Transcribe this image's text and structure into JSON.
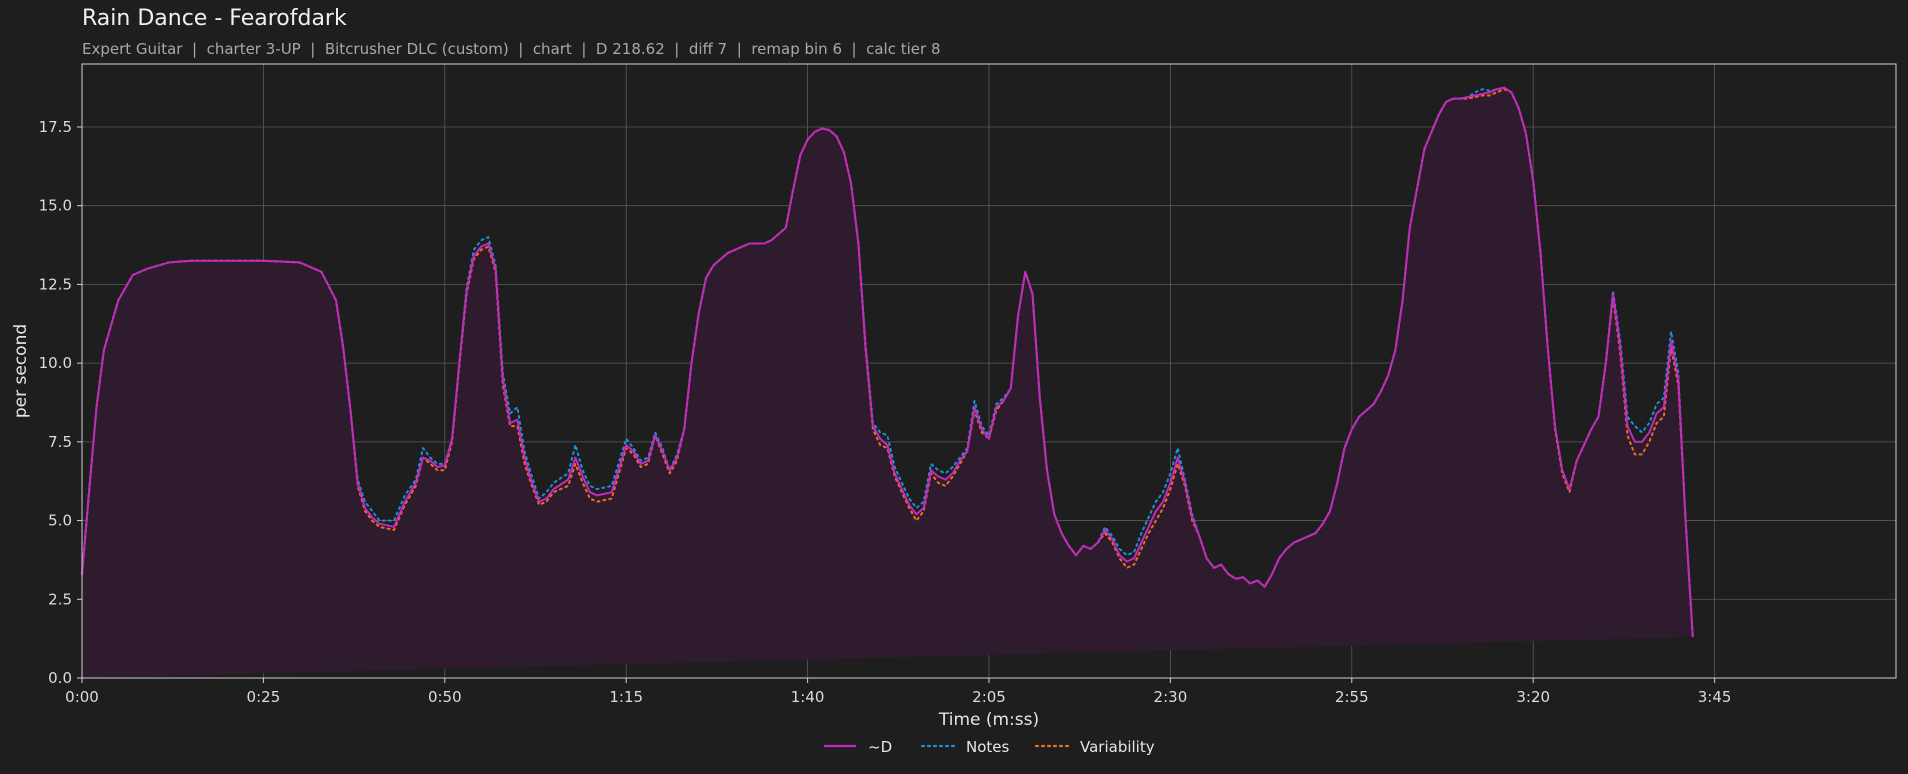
{
  "title": "Rain Dance - Fearofdark",
  "subtitle": "Expert Guitar  |  charter 3-UP  |  Bitcrusher DLC (custom)  |  chart  |  D 218.62  |  diff 7  |  remap bin 6  |  calc tier 8",
  "colors": {
    "background": "#1e1e1e",
    "D": "#c02bbd",
    "Notes": "#1f8fd6",
    "Variability": "#ef6c1f",
    "fill": "#2e1c2e",
    "grid": "#5a5a5a"
  },
  "chart_data": {
    "type": "line",
    "xlabel": "Time (m:ss)",
    "ylabel": "per second",
    "xlim": [
      0,
      250
    ],
    "ylim": [
      0,
      19.5
    ],
    "x_ticks": [
      0,
      25,
      50,
      75,
      100,
      125,
      150,
      175,
      200,
      225
    ],
    "x_tick_labels": [
      "0:00",
      "0:25",
      "0:50",
      "1:15",
      "1:40",
      "2:05",
      "2:30",
      "2:55",
      "3:20",
      "3:45"
    ],
    "y_ticks": [
      0,
      2.5,
      5,
      7.5,
      10,
      12.5,
      15,
      17.5
    ],
    "y_tick_labels": [
      "0.0",
      "2.5",
      "5.0",
      "7.5",
      "10.0",
      "12.5",
      "15.0",
      "17.5"
    ],
    "grid": true,
    "legend_position": "bottom-center",
    "x": [
      0,
      1,
      2,
      3,
      5,
      7,
      9,
      12,
      15,
      20,
      25,
      30,
      33,
      35,
      36,
      37,
      38,
      39,
      40,
      41,
      43,
      44.5,
      46,
      47,
      48,
      49,
      50,
      51,
      52,
      53,
      54,
      55,
      56,
      57,
      58,
      59,
      60,
      61,
      62,
      63,
      64,
      65,
      67,
      68,
      69,
      70,
      71,
      72,
      73,
      75,
      76,
      77,
      78,
      79,
      80,
      81,
      82,
      83,
      84,
      85,
      86,
      87,
      88,
      89,
      90,
      91,
      92,
      93,
      94,
      95,
      96,
      97,
      98,
      99,
      100,
      101,
      102,
      103,
      104,
      105,
      106,
      107,
      108,
      109,
      110,
      111,
      112,
      113,
      114,
      115,
      116,
      117,
      118,
      119,
      120,
      121,
      122,
      123,
      124,
      125,
      126,
      127,
      128,
      129,
      130,
      131,
      132,
      133,
      134,
      135,
      136,
      137,
      138,
      139,
      140,
      141,
      142,
      143,
      144,
      145,
      146,
      147,
      148,
      149,
      150,
      151,
      152,
      153,
      154,
      155,
      156,
      157,
      158,
      159,
      160,
      161,
      162,
      163,
      164,
      165,
      166,
      167,
      168,
      169,
      170,
      171,
      172,
      173,
      174,
      175,
      176,
      177,
      178,
      179,
      180,
      181,
      182,
      183,
      185,
      187,
      188,
      189,
      190,
      191,
      192,
      193,
      194,
      195,
      196,
      197,
      198,
      199,
      200,
      201,
      202,
      203,
      204,
      205,
      206,
      207,
      208,
      209,
      210,
      211,
      212,
      213,
      214,
      215,
      216,
      217,
      218,
      219,
      220,
      221,
      222,
      223,
      224,
      225,
      226,
      227,
      228,
      229,
      230,
      231,
      232,
      233,
      234,
      235,
      236,
      237,
      238,
      239,
      240,
      241,
      242,
      243,
      244,
      245,
      246,
      247,
      248,
      249,
      250
    ],
    "series": [
      {
        "name": "~D",
        "style": "solid",
        "values": [
          3.3,
          6.0,
          8.6,
          10.4,
          12.0,
          12.8,
          13.0,
          13.2,
          13.25,
          13.25,
          13.25,
          13.2,
          12.9,
          12.0,
          10.5,
          8.5,
          6.2,
          5.4,
          5.1,
          4.9,
          4.8,
          5.6,
          6.2,
          7.0,
          6.9,
          6.7,
          6.75,
          7.6,
          10.0,
          12.3,
          13.4,
          13.7,
          13.8,
          13.0,
          9.5,
          8.1,
          8.2,
          7.0,
          6.2,
          5.6,
          5.7,
          6.0,
          6.3,
          7.0,
          6.4,
          5.9,
          5.8,
          5.85,
          5.9,
          7.4,
          7.2,
          6.8,
          6.9,
          7.7,
          7.2,
          6.6,
          7.0,
          7.9,
          10.0,
          11.6,
          12.7,
          13.1,
          13.3,
          13.5,
          13.6,
          13.7,
          13.8,
          13.8,
          13.8,
          13.9,
          14.1,
          14.3,
          15.5,
          16.6,
          17.1,
          17.35,
          17.45,
          17.4,
          17.2,
          16.7,
          15.7,
          13.8,
          10.5,
          8.0,
          7.6,
          7.4,
          6.5,
          6.0,
          5.5,
          5.2,
          5.4,
          6.6,
          6.4,
          6.3,
          6.5,
          6.9,
          7.2,
          8.6,
          7.9,
          7.6,
          8.6,
          8.8,
          9.2,
          11.5,
          12.9,
          12.2,
          8.9,
          6.6,
          5.2,
          4.6,
          4.2,
          3.9,
          4.2,
          4.1,
          4.3,
          4.7,
          4.4,
          3.9,
          3.7,
          3.8,
          4.3,
          4.8,
          5.3,
          5.6,
          6.2,
          7.0,
          6.2,
          5.1,
          4.5,
          3.8,
          3.5,
          3.6,
          3.3,
          3.15,
          3.2,
          3.0,
          3.1,
          2.9,
          3.3,
          3.8,
          4.1,
          4.3,
          4.4,
          4.5,
          4.6,
          4.9,
          5.3,
          6.2,
          7.3,
          7.9,
          8.3,
          8.5,
          8.7,
          9.1,
          9.6,
          10.4,
          12.0,
          14.3,
          16.8,
          17.9,
          18.3,
          18.4,
          18.4,
          18.45,
          18.5,
          18.55,
          18.6,
          18.7,
          18.75,
          18.6,
          18.1,
          17.3,
          15.8,
          13.5,
          10.5,
          8.0,
          6.6,
          6.0,
          6.9,
          7.4,
          7.9,
          8.3,
          10.0,
          12.2,
          10.5,
          8.0,
          7.5,
          7.5,
          7.8,
          8.4,
          8.6,
          10.7,
          9.5,
          5.0,
          1.3
        ]
      },
      {
        "name": "Notes",
        "style": "dotted",
        "values": [
          3.3,
          6.0,
          8.6,
          10.4,
          12.0,
          12.8,
          13.0,
          13.2,
          13.25,
          13.25,
          13.25,
          13.2,
          12.9,
          12.0,
          10.5,
          8.5,
          6.3,
          5.6,
          5.3,
          5.0,
          5.0,
          5.8,
          6.3,
          7.3,
          7.0,
          6.8,
          6.8,
          7.6,
          10.0,
          12.4,
          13.6,
          13.9,
          14.0,
          13.1,
          9.7,
          8.4,
          8.6,
          7.2,
          6.4,
          5.7,
          5.9,
          6.2,
          6.5,
          7.4,
          6.6,
          6.1,
          6.0,
          6.05,
          6.1,
          7.6,
          7.3,
          6.9,
          7.0,
          7.8,
          7.3,
          6.6,
          7.1,
          7.9,
          10.0,
          11.6,
          12.7,
          13.1,
          13.3,
          13.5,
          13.6,
          13.7,
          13.8,
          13.8,
          13.8,
          13.9,
          14.1,
          14.3,
          15.5,
          16.6,
          17.1,
          17.35,
          17.45,
          17.4,
          17.2,
          16.7,
          15.7,
          13.8,
          10.6,
          8.1,
          7.8,
          7.7,
          6.7,
          6.2,
          5.7,
          5.4,
          5.6,
          6.8,
          6.6,
          6.5,
          6.7,
          7.0,
          7.3,
          8.8,
          8.0,
          7.7,
          8.7,
          8.9,
          9.2,
          11.5,
          12.9,
          12.2,
          8.9,
          6.6,
          5.2,
          4.6,
          4.2,
          3.9,
          4.2,
          4.1,
          4.3,
          4.8,
          4.5,
          4.1,
          3.9,
          4.0,
          4.6,
          5.1,
          5.6,
          5.9,
          6.5,
          7.3,
          6.3,
          5.2,
          4.5,
          3.8,
          3.5,
          3.6,
          3.3,
          3.15,
          3.2,
          3.0,
          3.1,
          2.9,
          3.3,
          3.8,
          4.1,
          4.3,
          4.4,
          4.5,
          4.6,
          4.9,
          5.3,
          6.2,
          7.3,
          7.9,
          8.3,
          8.5,
          8.7,
          9.1,
          9.6,
          10.4,
          12.0,
          14.3,
          16.8,
          17.9,
          18.3,
          18.4,
          18.4,
          18.45,
          18.6,
          18.7,
          18.65,
          18.7,
          18.75,
          18.6,
          18.1,
          17.3,
          15.8,
          13.5,
          10.5,
          8.0,
          6.6,
          6.0,
          6.9,
          7.4,
          7.9,
          8.3,
          10.0,
          12.3,
          10.7,
          8.3,
          8.0,
          7.8,
          8.1,
          8.7,
          8.9,
          11.0,
          9.7,
          5.0,
          1.3
        ]
      },
      {
        "name": "Variability",
        "style": "dotted",
        "values": [
          3.3,
          6.0,
          8.6,
          10.4,
          12.0,
          12.8,
          13.0,
          13.2,
          13.25,
          13.25,
          13.25,
          13.2,
          12.9,
          12.0,
          10.5,
          8.5,
          6.1,
          5.3,
          5.0,
          4.8,
          4.7,
          5.5,
          6.1,
          7.0,
          6.8,
          6.6,
          6.6,
          7.5,
          9.9,
          12.2,
          13.3,
          13.6,
          13.7,
          12.9,
          9.3,
          8.0,
          8.0,
          6.8,
          6.1,
          5.5,
          5.6,
          5.9,
          6.1,
          6.8,
          6.2,
          5.7,
          5.6,
          5.65,
          5.7,
          7.3,
          7.1,
          6.7,
          6.8,
          7.7,
          7.1,
          6.5,
          6.9,
          7.9,
          10.0,
          11.6,
          12.7,
          13.1,
          13.3,
          13.5,
          13.6,
          13.7,
          13.8,
          13.8,
          13.8,
          13.9,
          14.1,
          14.3,
          15.5,
          16.6,
          17.1,
          17.35,
          17.45,
          17.4,
          17.2,
          16.7,
          15.7,
          13.8,
          10.4,
          7.9,
          7.4,
          7.3,
          6.4,
          5.9,
          5.4,
          5.0,
          5.3,
          6.5,
          6.2,
          6.1,
          6.4,
          6.8,
          7.2,
          8.5,
          7.8,
          7.6,
          8.5,
          8.8,
          9.2,
          11.5,
          12.9,
          12.2,
          8.9,
          6.6,
          5.2,
          4.6,
          4.2,
          3.9,
          4.2,
          4.1,
          4.3,
          4.6,
          4.3,
          3.8,
          3.5,
          3.6,
          4.1,
          4.6,
          5.0,
          5.4,
          6.0,
          6.8,
          6.1,
          5.0,
          4.5,
          3.8,
          3.5,
          3.6,
          3.3,
          3.15,
          3.2,
          3.0,
          3.1,
          2.9,
          3.3,
          3.8,
          4.1,
          4.3,
          4.4,
          4.5,
          4.6,
          4.9,
          5.3,
          6.2,
          7.3,
          7.9,
          8.3,
          8.5,
          8.7,
          9.1,
          9.6,
          10.4,
          12.0,
          14.3,
          16.8,
          17.9,
          18.3,
          18.4,
          18.4,
          18.4,
          18.45,
          18.5,
          18.5,
          18.6,
          18.7,
          18.6,
          18.1,
          17.3,
          15.8,
          13.5,
          10.5,
          7.9,
          6.5,
          5.9,
          6.9,
          7.4,
          7.9,
          8.3,
          10.0,
          12.1,
          10.3,
          7.7,
          7.1,
          7.1,
          7.5,
          8.1,
          8.3,
          10.5,
          9.3,
          5.0,
          1.3
        ]
      }
    ]
  }
}
